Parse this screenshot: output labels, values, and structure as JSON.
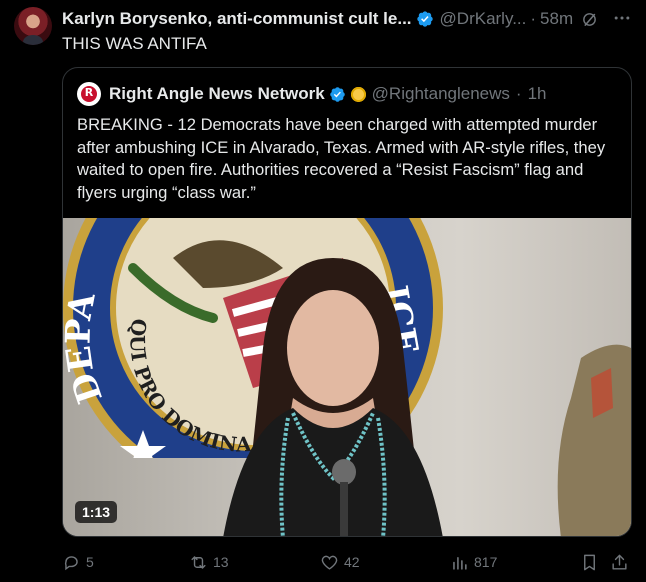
{
  "tweet": {
    "author_name": "Karlyn Borysenko, anti-communist cult le...",
    "handle": "@DrKarly...",
    "separator": "·",
    "time": "58m",
    "text": "THIS WAS ANTIFA"
  },
  "quoted_tweet": {
    "logo_letter": "R",
    "author_name": "Right Angle News Network",
    "handle": "@Rightanglenews",
    "separator": "·",
    "time": "1h",
    "text": "BREAKING - 12 Democrats have been charged with attempted murder after ambushing ICE in Alvarado, Texas. Armed with AR-style rifles, they waited to open fire. Authorities recovered a “Resist Fascism” flag and flyers urging “class war.”",
    "video": {
      "duration": "1:13",
      "seal_text_top": "DEPA",
      "seal_text_right": "ICE",
      "seal_motto": "QUI PRO DOMINA"
    }
  },
  "actions": {
    "replies": "5",
    "reposts": "13",
    "likes": "42",
    "views": "817"
  },
  "colors": {
    "background": "#000000",
    "text": "#e7e9ea",
    "muted": "#71767b",
    "verified": "#1d9bf0",
    "border": "#2f3336"
  }
}
